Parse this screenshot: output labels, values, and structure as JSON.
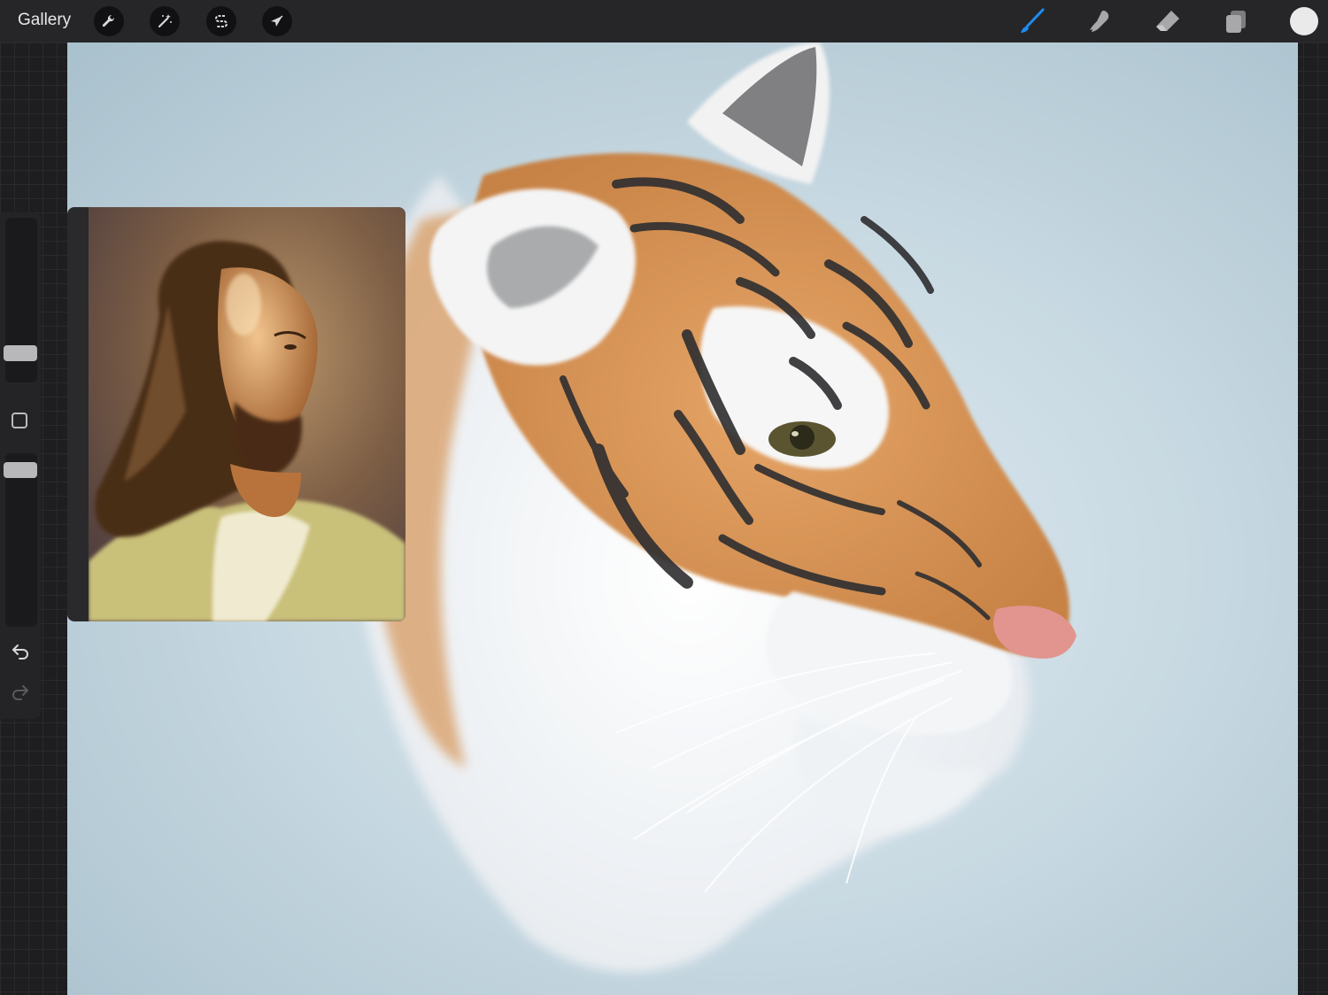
{
  "topbar": {
    "gallery_label": "Gallery",
    "left_tools": [
      {
        "name": "actions",
        "icon": "wrench-icon"
      },
      {
        "name": "adjustments",
        "icon": "magic-wand-icon"
      },
      {
        "name": "selection",
        "icon": "selection-s-icon"
      },
      {
        "name": "transform",
        "icon": "arrow-cursor-icon"
      }
    ],
    "right_tools": [
      {
        "name": "brush",
        "icon": "brush-icon",
        "active": true
      },
      {
        "name": "smudge",
        "icon": "smudge-icon"
      },
      {
        "name": "eraser",
        "icon": "eraser-icon"
      },
      {
        "name": "layers",
        "icon": "layers-icon"
      }
    ],
    "current_color": "#eaeaea",
    "accent_color": "#1e8cf0"
  },
  "sidebar": {
    "brush_size_level": 0.17,
    "opacity_level": 0.94,
    "modify_icon": "square-icon",
    "undo_icon": "undo-icon",
    "redo_icon": "redo-icon"
  },
  "reference_window": {
    "content": "portrait-painting"
  },
  "canvas": {
    "content": "tiger-painting"
  }
}
